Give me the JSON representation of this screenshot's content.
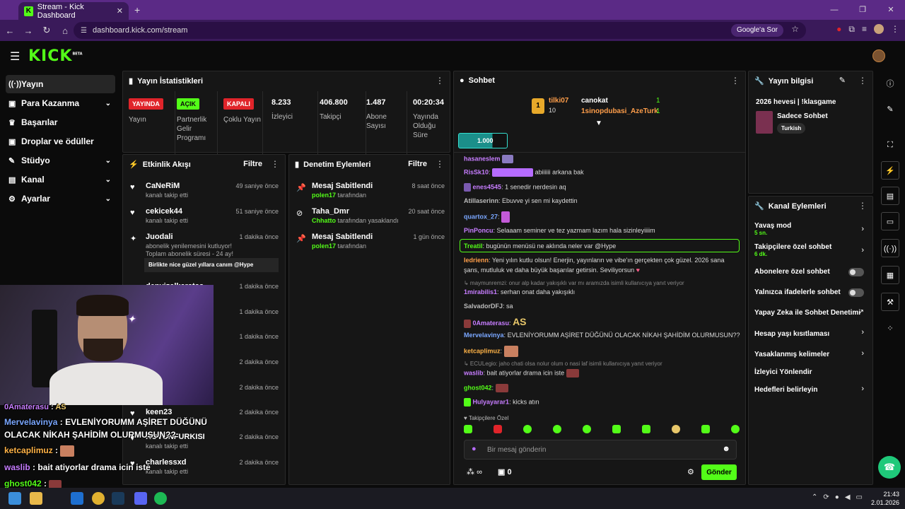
{
  "browser": {
    "tab_title": "Stream - Kick Dashboard",
    "tab_close": "✕",
    "new_tab": "+",
    "url": "dashboard.kick.com/stream",
    "google_chip": "Google'a Sor",
    "window_controls": [
      "—",
      "❐",
      "✕"
    ]
  },
  "header": {
    "logo": "KICK",
    "logo_sup": "BETA"
  },
  "sidebar": {
    "items": [
      {
        "label": "Yayın",
        "icon": "((·))",
        "active": true
      },
      {
        "label": "Para Kazanma",
        "icon": "▣",
        "chevron": true
      },
      {
        "label": "Başarılar",
        "icon": "🏆"
      },
      {
        "label": "Droplar ve ödüller",
        "icon": "▣"
      },
      {
        "label": "Stüdyo",
        "icon": "✎",
        "chevron": true
      },
      {
        "label": "Kanal",
        "icon": "▤",
        "chevron": true
      },
      {
        "label": "Ayarlar",
        "icon": "⚙",
        "chevron": true
      }
    ]
  },
  "stats": {
    "title": "Yayın İstatistikleri",
    "items": [
      {
        "badge": "YAYINDA",
        "badge_color": "#e0242a",
        "label": "Yayın"
      },
      {
        "badge": "AÇIK",
        "badge_color": "#53fc18",
        "label": "Partnerlik Gelir Programı"
      },
      {
        "badge": "KAPALI",
        "badge_color": "#e0242a",
        "label": "Çoklu Yayın"
      },
      {
        "value": "8.233",
        "label": "İzleyici"
      },
      {
        "value": "406.800",
        "label": "Takipçi"
      },
      {
        "value": "1.487",
        "label": "Abone Sayısı"
      },
      {
        "value": "00:20:34",
        "label": "Yayında Olduğu Süre"
      }
    ]
  },
  "activity": {
    "title": "Etkinlik Akışı",
    "filter": "Filtre",
    "items": [
      {
        "name": "CaNeRiM",
        "sub": "kanalı takip etti",
        "time": "49 saniye önce"
      },
      {
        "name": "cekicek44",
        "sub": "kanalı takip etti",
        "time": "51 saniye önce"
      },
      {
        "name": "Juodali",
        "sub": "abonelik yenilemesini kutluyor! Toplam abonelik süresi - 24 ay!",
        "time": "1 dakika önce",
        "msg": "Birlikte nice güzel yıllara canım @Hype"
      },
      {
        "name": "denyizalkaratas",
        "time": "1 dakika önce"
      },
      {
        "time": "1 dakika önce"
      },
      {
        "time": "1 dakika önce"
      },
      {
        "time": "2 dakika önce"
      },
      {
        "time": "2 dakika önce"
      },
      {
        "name": "keen23",
        "time": "2 dakika önce"
      },
      {
        "name": "ROVUNFURKISI",
        "sub": "kanalı takip etti",
        "time": "2 dakika önce"
      },
      {
        "name": "charlessxd",
        "sub": "kanalı takip etti",
        "time": "2 dakika önce"
      }
    ]
  },
  "moderation": {
    "title": "Denetim Eylemleri",
    "filter": "Filtre",
    "items": [
      {
        "action": "Mesaj Sabitlendi",
        "actor": "polen17",
        "suffix": "tarafından",
        "time": "8 saat önce"
      },
      {
        "action": "Taha_Dmr",
        "actor": "Chhatto",
        "suffix": "tarafından yasaklandı",
        "time": "20 saat önce"
      },
      {
        "action": "Mesaj Sabitlendi",
        "actor": "polen17",
        "suffix": "tarafından",
        "time": "1 gün önce"
      }
    ]
  },
  "chat": {
    "title": "Sohbet",
    "leaderboard": [
      {
        "rank": "1",
        "name": "tilki07",
        "score": "10"
      },
      {
        "name": "canokat",
        "score": "1"
      },
      {
        "name": "1sinopdubasi_AzeTurk",
        "score": "1"
      }
    ],
    "pill": "1.000",
    "messages": [
      {
        "user": "hasaneslem",
        "color": "#c77dff",
        "text": ""
      },
      {
        "user": "RisSk10",
        "color": "#c77dff",
        "text": "abiiiiii arkana bak"
      },
      {
        "user": "enes4545",
        "color": "#c77dff",
        "text": "1 senedir nerdesin aq"
      },
      {
        "user": "Atillaserinn",
        "color": "#bbbbbb",
        "text": "Ebuvve yi sen mi kaydettin"
      },
      {
        "user": "quartox_27",
        "color": "#7aa7ff",
        "text": ""
      },
      {
        "user": "PinPoncu",
        "color": "#c77dff",
        "text": "Selaaam seminer ve tez yazmam lazım hala sizinleyiiiim"
      },
      {
        "user": "Treatil",
        "color": "#53fc18",
        "text": "bugünün menüsü ne aklında neler var @Hype"
      },
      {
        "user": "Iedrienn",
        "color": "#ff9e4a",
        "text": "Yeni yılın kutlu olsun! Enerjin, yayınların ve vibe'ın gerçekten çok güzel. 2026 sana"
      },
      {
        "user": "",
        "color": "#ddd",
        "text": "şans, mutluluk ve daha büyük başarılar getirsin. Seviliyorsun"
      },
      {
        "user": "",
        "color": "#888",
        "text": "↳ maymunremzi: onur alp kadar yakışıklı var mı aramızda isimli kullanıcıya yanıt veriyor"
      },
      {
        "user": "1mirabilis1",
        "color": "#c77dff",
        "text": "serhan onat daha yakışıklı"
      },
      {
        "user": "SalvadorDFJ",
        "color": "#bbbbbb",
        "text": "sa"
      },
      {
        "user": "0Amaterasu",
        "color": "#c77dff",
        "text": ""
      },
      {
        "user": "Mervelavinya",
        "color": "#7aa7ff",
        "text": "EVLENİYORUMM AŞİRET DÜĞÜNÜ OLACAK NİKAH ŞAHİDİM OLURMUSUN??"
      },
      {
        "user": "ketcaplimuz",
        "color": "#ffb347",
        "text": ""
      },
      {
        "user": "",
        "color": "#888",
        "text": "↳ ECULegio: jaho chati olsa nolur olum o nasi laf isimli kullanıcıya yanıt veriyor"
      },
      {
        "user": "waslib",
        "color": "#c77dff",
        "text": "bait atiyorlar drama icin iste"
      },
      {
        "user": "ghost042",
        "color": "#53fc18",
        "text": ""
      },
      {
        "user": "Hulyayarar1",
        "color": "#c77dff",
        "text": "kicks atın"
      }
    ],
    "followers_only": "Takipçilere Özel",
    "placeholder": "Bir mesaj gönderin",
    "send": "Gönder",
    "infinity": "∞",
    "count": "0"
  },
  "stream_info": {
    "title": "Yayın bilgisi",
    "stream_title": "2026 hevesi | !klasgame",
    "category": "Sadece Sohbet",
    "tag": "Turkish"
  },
  "channel_actions": {
    "title": "Kanal Eylemleri",
    "items": [
      {
        "label": "Yavaş mod",
        "sub": "5 sn.",
        "type": "chevron"
      },
      {
        "label": "Takipçilere özel sohbet",
        "sub": "6 dk.",
        "type": "chevron"
      },
      {
        "label": "Abonelere özel sohbet",
        "type": "toggle"
      },
      {
        "label": "Yalnızca ifadelerle sohbet",
        "type": "toggle"
      },
      {
        "label": "Yapay Zeka ile Sohbet Denetimi",
        "type": "external"
      },
      {
        "label": "Hesap yaşı kısıtlaması",
        "type": "chevron"
      },
      {
        "label": "Yasaklanmış kelimeler",
        "type": "chevron"
      },
      {
        "label": "İzleyici Yönlendir",
        "type": "none"
      },
      {
        "label": "Hedefleri belirleyin",
        "type": "chevron"
      }
    ]
  },
  "overlay": {
    "lines": [
      {
        "user": "0Amaterasu",
        "color": "#c77dff",
        "text": ""
      },
      {
        "user": "Mervelavinya",
        "color": "#7aa7ff",
        "text": "EVLENİYORUMM AŞİRET DÜĞÜNÜ"
      },
      {
        "user": "",
        "color": "#fff",
        "text": "OLACAK NİKAH ŞAHİDİM OLURMUSUN??"
      },
      {
        "user": "ketcaplimuz",
        "color": "#ffb347",
        "text": ""
      },
      {
        "user": "waslib",
        "color": "#c77dff",
        "text": "bait atiyorlar drama icin iste"
      },
      {
        "user": "ghost042",
        "color": "#53fc18",
        "text": ""
      }
    ]
  },
  "taskbar": {
    "time": "21:43",
    "date": "2.01.2026"
  },
  "colors": {
    "accent": "#53fc18",
    "live": "#e0242a",
    "panel": "#161616"
  }
}
